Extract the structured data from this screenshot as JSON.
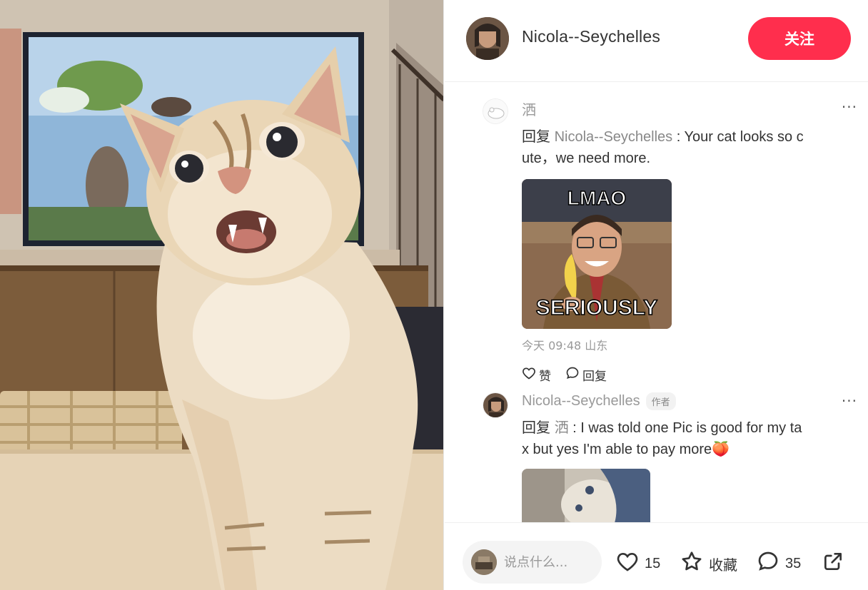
{
  "header": {
    "author_name": "Nicola--Seychelles",
    "follow_label": "关注"
  },
  "comments": [
    {
      "author": "洒",
      "reply_prefix": "回复",
      "reply_to": "Nicola--Seychelles",
      "separator": " : ",
      "text": "Your cat looks so cute，we need more.",
      "image": {
        "type": "meme",
        "top_text": "LMAO",
        "bottom_text": "SERIOUSLY"
      },
      "time": "今天 09:48",
      "location": "山东",
      "like_label": "赞",
      "reply_label": "回复"
    },
    {
      "author": "Nicola--Seychelles",
      "author_tag": "作者",
      "reply_prefix": "回复",
      "reply_to": "洒",
      "separator": " : ",
      "text": "I was told one Pic is good for my tax but yes I'm able to pay more",
      "emoji": "🍑"
    }
  ],
  "more_label": "···",
  "bottom_bar": {
    "input_placeholder": "说点什么...",
    "likes_count": "15",
    "collect_label": "收藏",
    "comments_count": "35"
  },
  "icons": {
    "heart": "heart-icon",
    "star": "star-icon",
    "comment": "comment-bubble-icon",
    "share": "share-icon"
  },
  "colors": {
    "follow_button": "#ff2e4d",
    "secondary_text": "#999999"
  }
}
